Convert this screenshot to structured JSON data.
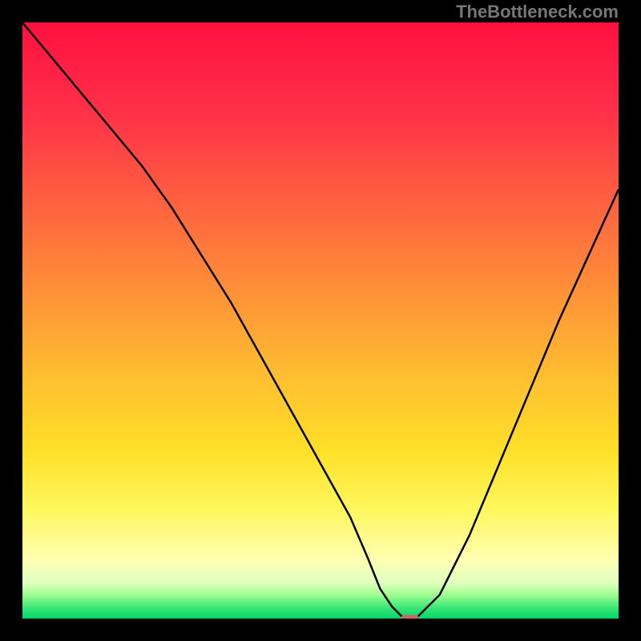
{
  "watermark": "TheBottleneck.com",
  "chart_data": {
    "type": "line",
    "title": "",
    "xlabel": "",
    "ylabel": "",
    "xlim": [
      0,
      100
    ],
    "ylim": [
      0,
      100
    ],
    "x": [
      0,
      5,
      10,
      15,
      20,
      25,
      30,
      35,
      40,
      45,
      50,
      55,
      58,
      60,
      62,
      64,
      66,
      70,
      75,
      80,
      85,
      90,
      95,
      100
    ],
    "values": [
      100,
      94,
      88,
      82,
      76,
      69,
      61,
      53,
      44,
      35,
      26,
      17,
      10,
      5,
      2,
      0,
      0,
      4,
      14,
      26,
      38,
      50,
      61,
      72
    ],
    "marker": {
      "x": 65,
      "y": 0,
      "color": "#cc6666",
      "width": 3,
      "height": 1.2
    },
    "background": {
      "type": "custom-gradient",
      "description": "Vertical gradient from red at top through orange and yellow to bright green band at very bottom",
      "stops": [
        {
          "pos": 0,
          "color": "#ff1040"
        },
        {
          "pos": 15,
          "color": "#ff3048"
        },
        {
          "pos": 30,
          "color": "#ff6040"
        },
        {
          "pos": 45,
          "color": "#ff9038"
        },
        {
          "pos": 60,
          "color": "#ffc030"
        },
        {
          "pos": 72,
          "color": "#ffe028"
        },
        {
          "pos": 82,
          "color": "#fff860"
        },
        {
          "pos": 90,
          "color": "#ffffb0"
        },
        {
          "pos": 94,
          "color": "#e0ffc0"
        },
        {
          "pos": 96,
          "color": "#a0ff90"
        },
        {
          "pos": 98,
          "color": "#40e878"
        },
        {
          "pos": 100,
          "color": "#00d868"
        }
      ]
    }
  }
}
